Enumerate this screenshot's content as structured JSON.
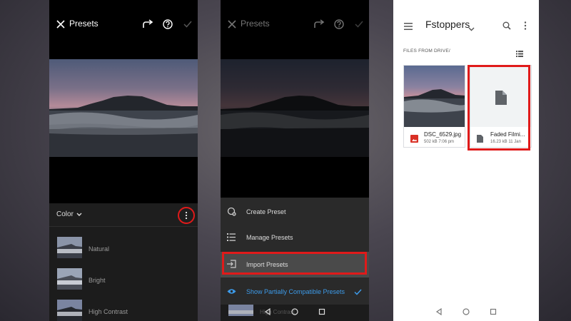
{
  "screen1": {
    "title": "Presets",
    "color_label": "Color",
    "presets": [
      {
        "name": "Natural"
      },
      {
        "name": "Bright"
      },
      {
        "name": "High Contrast"
      }
    ]
  },
  "screen2": {
    "title": "Presets",
    "menu": [
      {
        "label": "Create Preset",
        "icon": "create-preset-icon"
      },
      {
        "label": "Manage Presets",
        "icon": "list-icon"
      },
      {
        "label": "Import Presets",
        "icon": "import-icon"
      },
      {
        "label": "Show Partially Compatible Presets",
        "icon": "eye-icon"
      }
    ],
    "behind_text": "High Contrast"
  },
  "screen3": {
    "title": "Fstoppers",
    "section": "FILES FROM DRIVE/",
    "files": [
      {
        "name": "DSC_6529.jpg",
        "meta": "502 kB 7:06 pm",
        "icon": "image-icon"
      },
      {
        "name": "Faded Filmi...",
        "meta": "16.23 kB 11 Jan",
        "icon": "document-icon"
      }
    ]
  },
  "colors": {
    "accent_blue": "#3d9be9",
    "highlight_red": "#e01a1a",
    "dark_bg": "#000000",
    "panel_bg": "#1c1c1c"
  }
}
